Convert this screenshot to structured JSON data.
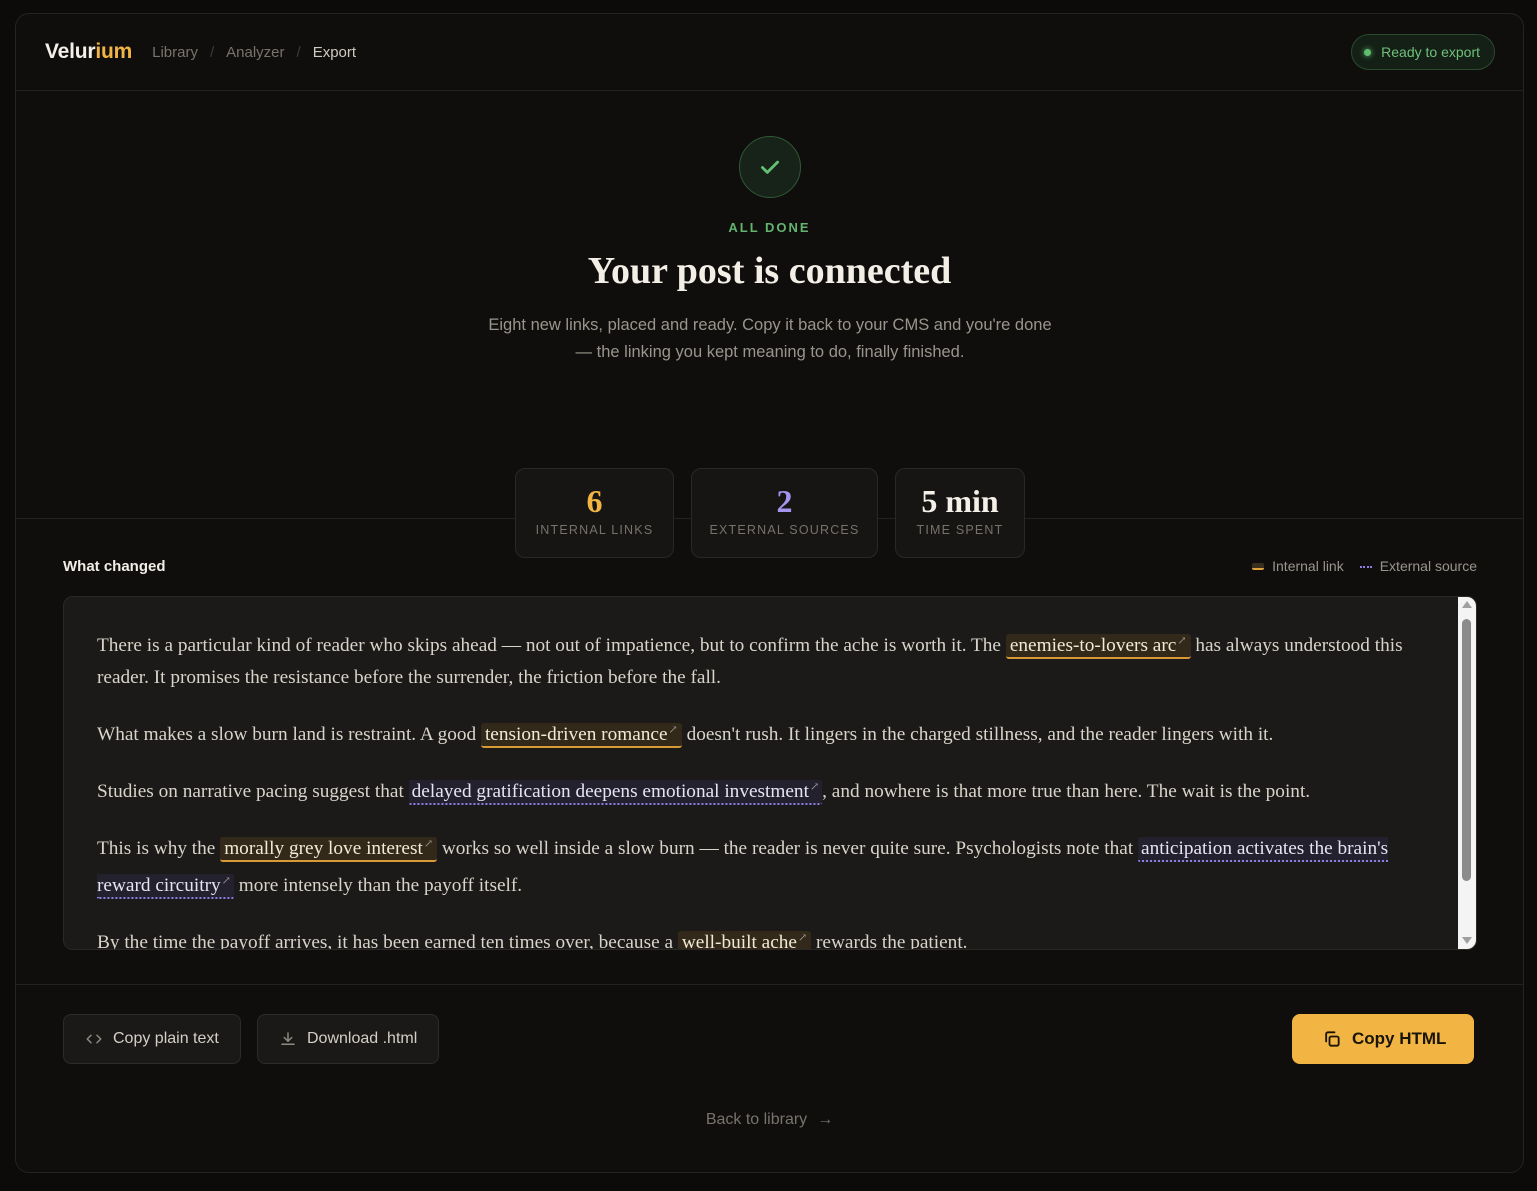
{
  "header": {
    "brand_primary": "Velur",
    "brand_accent": "ium",
    "breadcrumbs": [
      "Library",
      "Analyzer",
      "Export"
    ],
    "breadcrumb_separator": "/",
    "status": "Ready to export"
  },
  "hero": {
    "eyebrow": "ALL DONE",
    "title": "Your post is connected",
    "subtitle": "Eight new links, placed and ready. Copy it back to your CMS and you're done — the linking you kept meaning to do, finally finished.",
    "stats": [
      {
        "value": "6",
        "label": "INTERNAL LINKS",
        "color": "#f2b544"
      },
      {
        "value": "2",
        "label": "EXTERNAL SOURCES",
        "color": "#a495ef"
      },
      {
        "value": "5 min",
        "label": "TIME SPENT",
        "color": "#f4f0e8"
      }
    ]
  },
  "changes": {
    "title": "What changed",
    "legend": {
      "internal": "Internal link",
      "external": "External source"
    },
    "paragraphs": [
      {
        "t1": "There is a particular kind of reader who skips ahead — not out of impatience, but to confirm the ache is worth it. The ",
        "link1": "enemies-to-lovers arc",
        "t2": " has always understood this reader. It promises the resistance before the surrender, the friction before the fall."
      },
      {
        "t1": "What makes a slow burn land is restraint. A good ",
        "link1": "tension-driven romance",
        "t2": " doesn't rush. It lingers in the charged stillness, and the reader lingers with it."
      },
      {
        "t1": "Studies on narrative pacing suggest that ",
        "link1": "delayed gratification deepens emotional investment",
        "t2": ", and nowhere is that more true than here. The wait is the point."
      },
      {
        "t1": "This is why the ",
        "link1": "morally grey love interest",
        "t2": " works so well inside a slow burn — the reader is never quite sure. Psychologists note that ",
        "link2": "anticipation activates the brain's reward circuitry",
        "t3": " more intensely than the payoff itself."
      },
      {
        "t1": "By the time the payoff arrives, it has been earned ten times over, because a ",
        "link1": "well-built ache",
        "t2": " rewards the patient."
      }
    ],
    "external_mark": "↗"
  },
  "actions": {
    "copy_plain": "Copy plain text",
    "download": "Download .html",
    "copy_html": "Copy HTML",
    "back": "Back to library",
    "back_arrow": "→"
  },
  "icons": [
    "check-icon",
    "code-icon",
    "download-icon",
    "copy-icon",
    "arrow-right-icon"
  ]
}
